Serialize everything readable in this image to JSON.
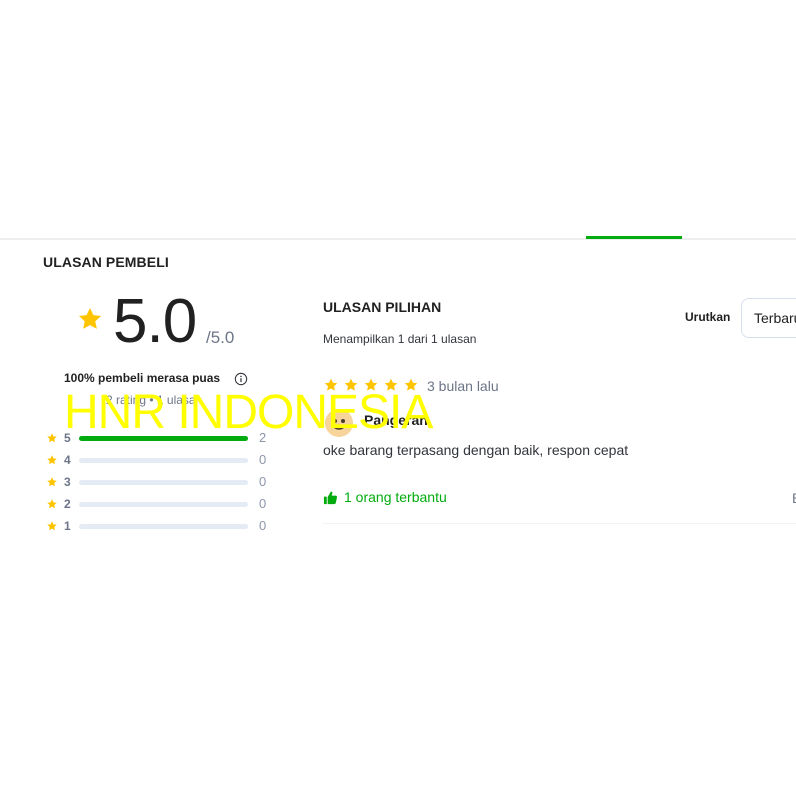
{
  "section_title": "ULASAN PEMBELI",
  "summary": {
    "score": "5.0",
    "max_score": "/5.0",
    "satisfaction": "100% pembeli merasa puas",
    "rating_count": "2 rating • 1 ulasan"
  },
  "distribution": [
    {
      "stars": "5",
      "count": "2",
      "fraction": 1.0
    },
    {
      "stars": "4",
      "count": "0",
      "fraction": 0
    },
    {
      "stars": "3",
      "count": "0",
      "fraction": 0
    },
    {
      "stars": "2",
      "count": "0",
      "fraction": 0
    },
    {
      "stars": "1",
      "count": "0",
      "fraction": 0
    }
  ],
  "pilihan": {
    "title": "ULASAN PILIHAN",
    "subtitle": "Menampilkan 1 dari 1 ulasan"
  },
  "sort": {
    "label": "Urutkan",
    "selected": "Terbaru"
  },
  "review": {
    "rating": 5,
    "time": "3 bulan lalu",
    "reviewer": "Pangeran",
    "text": "oke barang terpasang dengan baik, respon cepat",
    "helpful": "1 orang terbantu",
    "more": "Balas"
  },
  "watermark": "HNR INDONESIA",
  "colors": {
    "accent_green": "#03ac0e",
    "star_yellow": "#ffc400",
    "track_gray": "#e4ebf5"
  },
  "icons": {
    "star": "star-icon",
    "info": "info-icon",
    "thumbs_up": "thumbs-up-icon"
  }
}
